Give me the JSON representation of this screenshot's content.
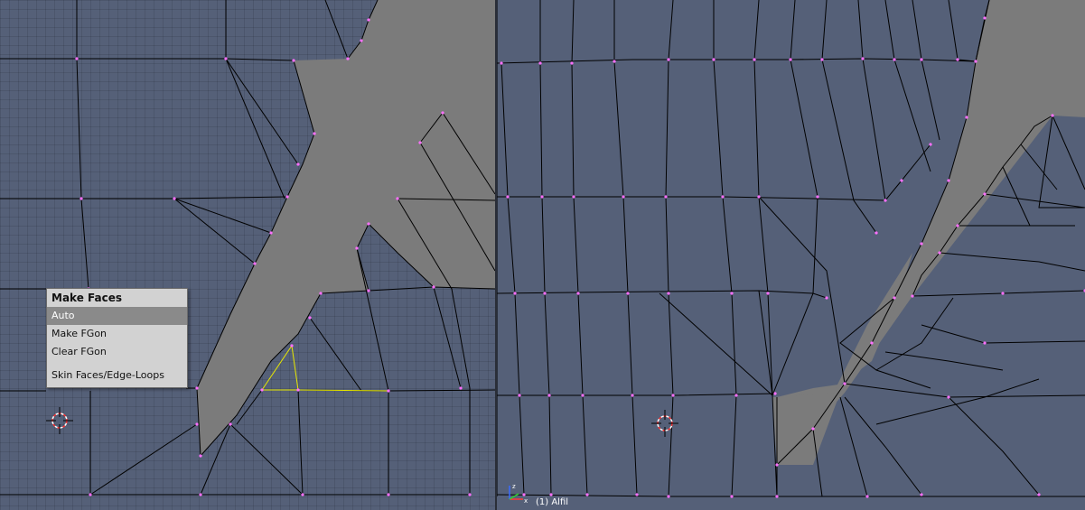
{
  "menu": {
    "title": "Make Faces",
    "items": [
      {
        "label": "Auto",
        "active": true
      },
      {
        "label": "Make FGon",
        "active": false
      },
      {
        "label": "Clear FGon",
        "active": false
      },
      {
        "label": "Skin Faces/Edge-Loops",
        "active": false
      }
    ]
  },
  "status": {
    "object_label": "(1) Alfil"
  },
  "colors": {
    "viewport_bg": "#556078",
    "face_fill": "#7a7a7a",
    "edge": "#000000",
    "vertex": "#ff70ff",
    "selected_edge": "#e8e800",
    "menu_bg": "#d2d2d2",
    "menu_highlight": "#8a8a8a"
  },
  "icons": [
    "3d-cursor-icon",
    "axis-gizmo-icon"
  ]
}
